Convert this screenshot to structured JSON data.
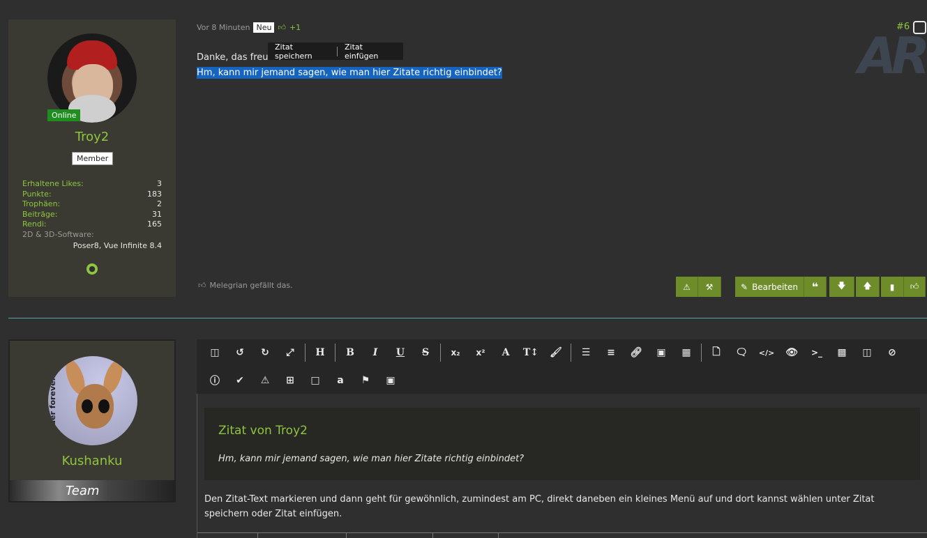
{
  "post1": {
    "user": {
      "online_label": "Online",
      "name": "Troy2",
      "rank": "Member",
      "stats": [
        {
          "label": "Erhaltene Likes:",
          "value": "3"
        },
        {
          "label": "Punkte:",
          "value": "183"
        },
        {
          "label": "Trophäen:",
          "value": "2"
        },
        {
          "label": "Beiträge:",
          "value": "31"
        },
        {
          "label": "Rendi:",
          "value": "165"
        }
      ],
      "software_label": "2D & 3D-Software:",
      "software_value": "Poser8, Vue Infinite 8.4"
    },
    "time": "Vor 8 Minuten",
    "new_badge": "Neu",
    "likes": "+1",
    "post_number": "#6",
    "line1": "Danke, das freut mich sehr!",
    "line2": "Hm, kann mir jemand sagen, wie man hier Zitate richtig einbindet?",
    "quote_menu": {
      "save": "Zitat speichern",
      "insert": "Zitat einfügen"
    },
    "liked_by": "Melegrian gefällt das.",
    "edit_label": "Bearbeiten"
  },
  "post2": {
    "user": {
      "name": "Kushanku",
      "team_label": "Team",
      "avatar_text": "Render forever"
    },
    "quote": {
      "title": "Zitat von Troy2",
      "text": "Hm, kann mir jemand sagen, wie man hier Zitate richtig einbindet?"
    },
    "reply": "Den Zitat-Text markieren und dann geht für gewöhnlich, zumindest am PC, direkt daneben ein kleines Menü auf und dort kannst wählen unter Zitat speichern oder Zitat einfügen."
  },
  "watermark": "AR",
  "colors": {
    "accent": "#8ec63f",
    "button": "#6e8c2a",
    "selection": "#1565c0",
    "online": "#1e8e1e"
  }
}
